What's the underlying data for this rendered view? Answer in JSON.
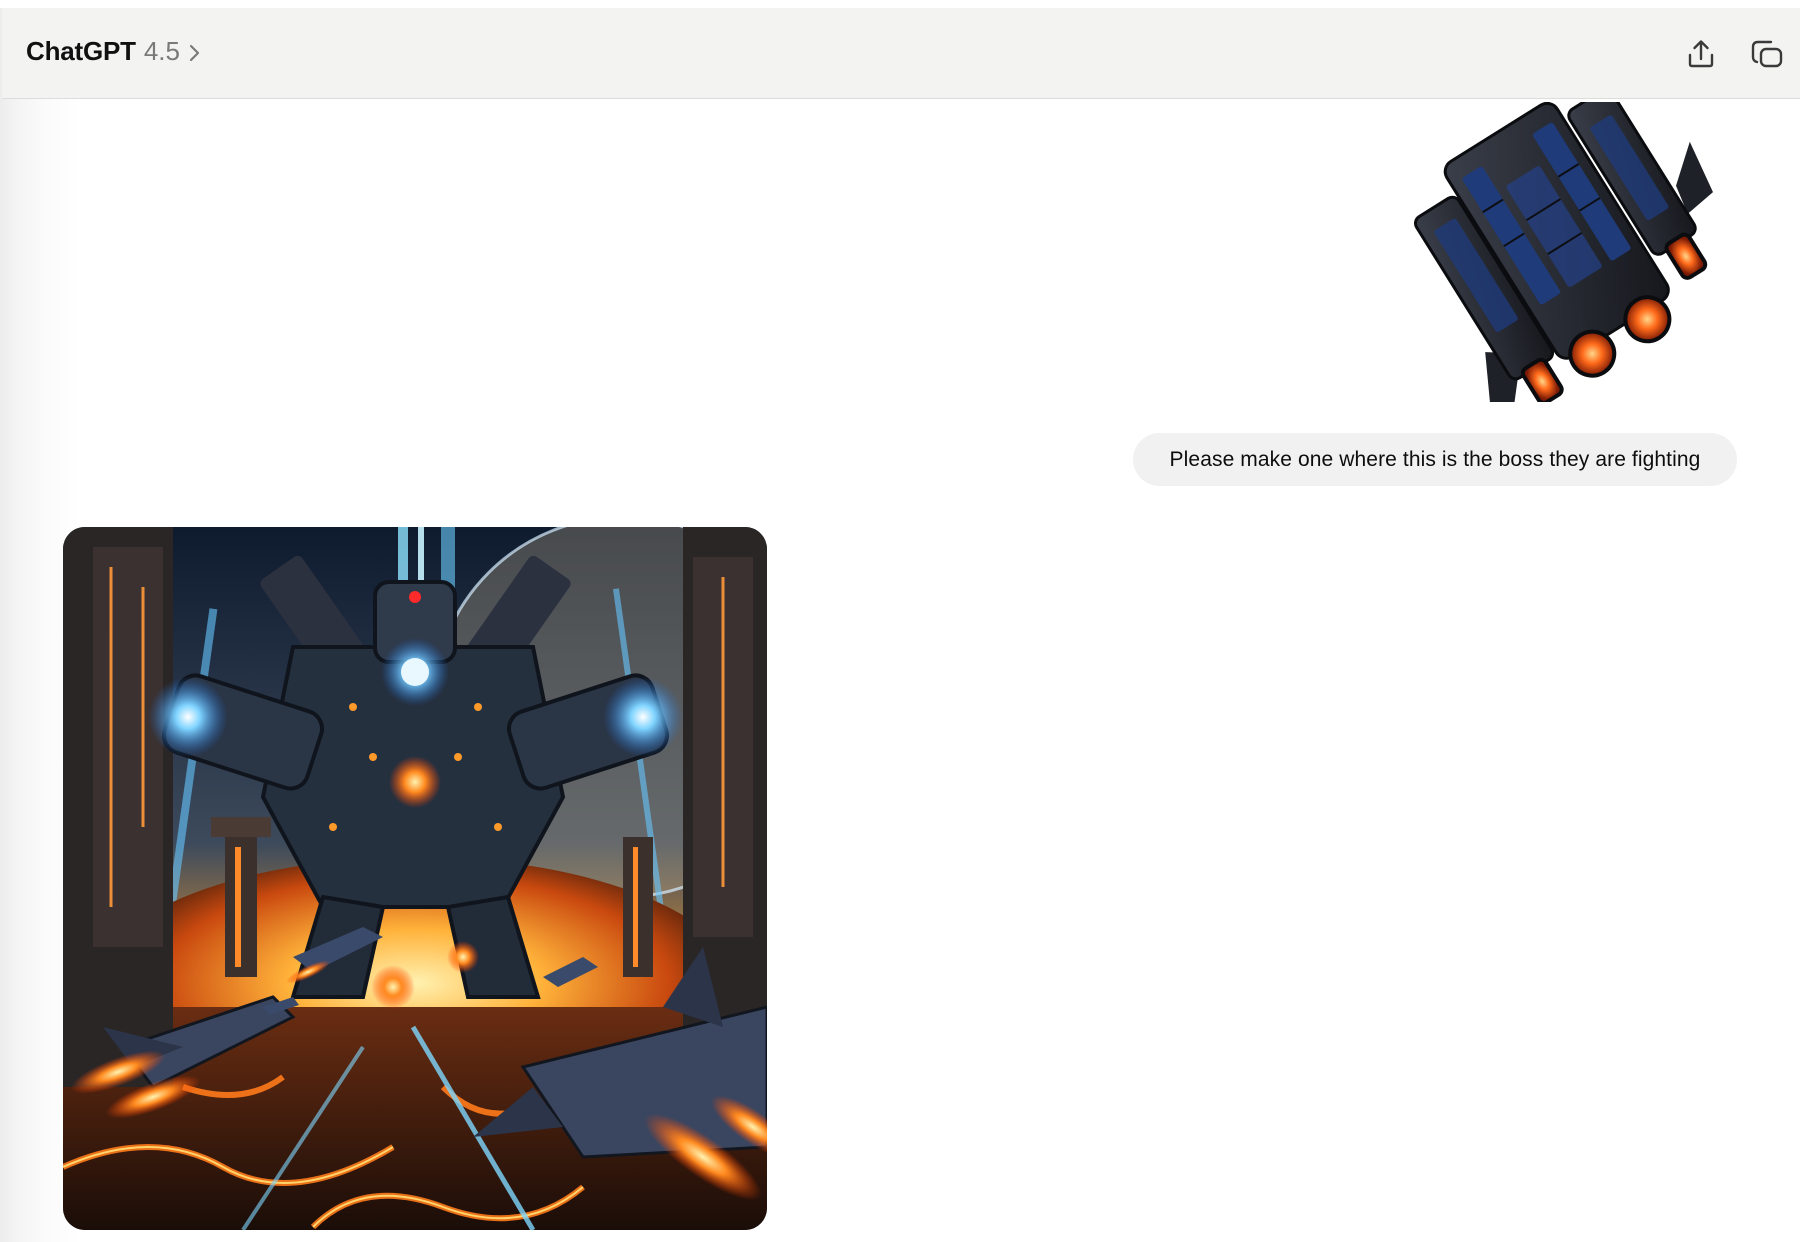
{
  "header": {
    "app_name": "ChatGPT",
    "model_version": "4.5",
    "icons": {
      "switcher": "chevron-right-icon",
      "share": "share-upload-icon",
      "new_chat": "new-chat-icon"
    }
  },
  "conversation": {
    "user_message": {
      "attachment_icon": "spaceship-image",
      "text": "Please make one where this is the boss they are fighting"
    },
    "assistant_message": {
      "generated_image": "space-battle-boss-image"
    }
  },
  "colors": {
    "header_bg": "#f3f3f2",
    "bubble_bg": "#f1f1f1",
    "text_primary": "#0d0d0d",
    "text_secondary": "#7a7a7a"
  }
}
